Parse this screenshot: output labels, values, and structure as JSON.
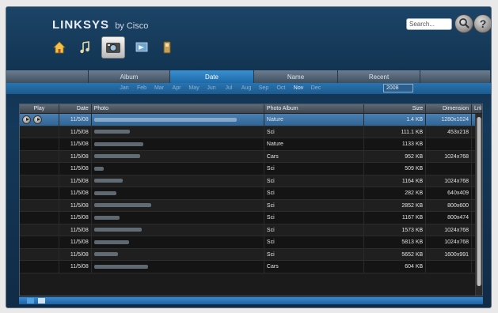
{
  "header": {
    "brand": "LINKSYS",
    "brand_suffix": "by Cisco",
    "search_placeholder": "Search...",
    "help_symbol": "?"
  },
  "nav_icons": [
    {
      "name": "home-icon",
      "active": false
    },
    {
      "name": "music-icon",
      "active": false
    },
    {
      "name": "photo-icon",
      "active": true
    },
    {
      "name": "video-icon",
      "active": false
    },
    {
      "name": "device-icon",
      "active": false
    }
  ],
  "tabs": [
    {
      "label": "",
      "active": false
    },
    {
      "label": "Album",
      "active": false
    },
    {
      "label": "Date",
      "active": true
    },
    {
      "label": "Name",
      "active": false
    },
    {
      "label": "Recent",
      "active": false
    },
    {
      "label": "",
      "active": false
    }
  ],
  "filter": {
    "months": [
      "Jan",
      "Feb",
      "Mar",
      "Apr",
      "May",
      "Jun",
      "Jul",
      "Aug",
      "Sep",
      "Oct",
      "Nov",
      "Dec"
    ],
    "year": "2008"
  },
  "table": {
    "columns": [
      "Play",
      "Date",
      "Photo",
      "Photo Album",
      "Size",
      "Dimension",
      "Lnk"
    ],
    "rows": [
      {
        "date": "11/5/08",
        "album": "Nature",
        "size": "1.4 KB",
        "dimension": "1280x1024",
        "selected": true,
        "photo_w": 180
      },
      {
        "date": "11/5/08",
        "album": "Sci",
        "size": "111.1 KB",
        "dimension": "453x218",
        "selected": false,
        "photo_w": 45
      },
      {
        "date": "11/5/08",
        "album": "Nature",
        "size": "1133 KB",
        "dimension": "",
        "selected": false,
        "photo_w": 62
      },
      {
        "date": "11/5/08",
        "album": "Cars",
        "size": "952 KB",
        "dimension": "1024x768",
        "selected": false,
        "photo_w": 58
      },
      {
        "date": "11/5/08",
        "album": "Sci",
        "size": "509 KB",
        "dimension": "",
        "selected": false,
        "photo_w": 12
      },
      {
        "date": "11/5/08",
        "album": "Sci",
        "size": "1164 KB",
        "dimension": "1024x768",
        "selected": false,
        "photo_w": 36
      },
      {
        "date": "11/5/08",
        "album": "Sci",
        "size": "282 KB",
        "dimension": "640x409",
        "selected": false,
        "photo_w": 28
      },
      {
        "date": "11/5/08",
        "album": "Sci",
        "size": "2852 KB",
        "dimension": "800x600",
        "selected": false,
        "photo_w": 72
      },
      {
        "date": "11/5/08",
        "album": "Sci",
        "size": "1167 KB",
        "dimension": "800x474",
        "selected": false,
        "photo_w": 32
      },
      {
        "date": "11/5/08",
        "album": "Sci",
        "size": "1573 KB",
        "dimension": "1024x768",
        "selected": false,
        "photo_w": 60
      },
      {
        "date": "11/5/08",
        "album": "Sci",
        "size": "5813 KB",
        "dimension": "1024x768",
        "selected": false,
        "photo_w": 44
      },
      {
        "date": "11/5/08",
        "album": "Sci",
        "size": "5652 KB",
        "dimension": "1600x991",
        "selected": false,
        "photo_w": 30
      },
      {
        "date": "11/5/08",
        "album": "Cars",
        "size": "604 KB",
        "dimension": "",
        "selected": false,
        "photo_w": 68
      }
    ]
  },
  "colors": {
    "background": "#123553",
    "accent": "#2a7fc4",
    "table_bg": "#1b1b1b",
    "selected_row": "#3d74a6"
  }
}
